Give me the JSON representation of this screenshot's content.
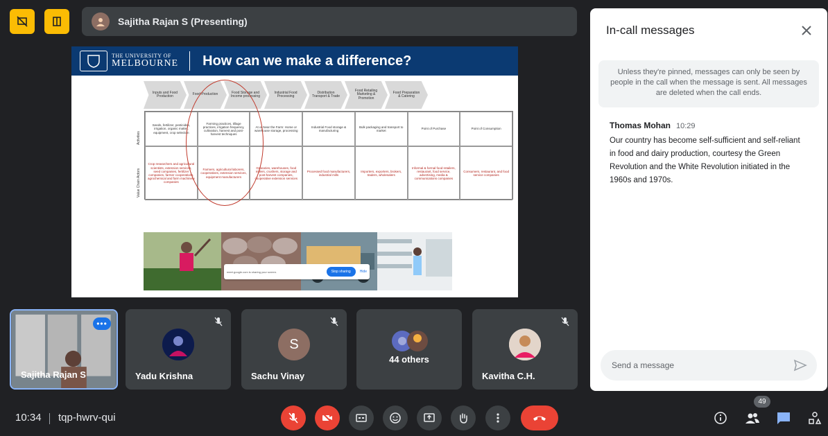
{
  "presenter": {
    "name": "Sajitha Rajan S (Presenting)"
  },
  "slide": {
    "university_line1": "THE UNIVERSITY OF",
    "university_line2": "MELBOURNE",
    "title": "How can we make a difference?",
    "stages": [
      "Inputs and Food Production",
      "Food Production",
      "Food Storage and Income processing",
      "Industrial Food Processing",
      "Distribution Transport & Trade",
      "Food Retailing Marketing & Promotion",
      "Food Preparation & Catering"
    ],
    "row_labels": [
      "Activities",
      "Value Chain Actors"
    ],
    "activities": [
      "Seeds, fertilizer, pesticides, irrigation, organic matter, equipment, crop selection",
      "Farming practices, tillage practices, irrigation frequency, cultivation, harvest and post-harvest techniques",
      "At or Near the Farm: Home or warehouse storage, processing",
      "Industrial Food storage & manufacturing",
      "Bulk packaging and transport to market",
      "Point of Purchase",
      "Point of Consumption"
    ],
    "actors": [
      "Crop researchers and agricultural scientists, extension services, seed companies, fertilizer companies, farmer cooperatives, agrochemical and farm machinery companies",
      "Farmers, agricultural laborers, cooperatives, extension services, equipment manufacturers",
      "Granaries, warehouses, food millers, crushers, storage and post-harvest companies, cooperative extension services",
      "Processed food manufacturers, industrial mills",
      "Importers, exporters, brokers, traders, wholesalers",
      "Informal & formal food retailers, restaurant, food service, advertising, media & communications companies",
      "Consumers, restaurant, and food service companies"
    ],
    "share_bar": {
      "text": "meet.google.com is sharing your screen.",
      "stop_label": "Stop sharing",
      "hide_label": "Hide"
    }
  },
  "participants": [
    {
      "name": "Sajitha Rajan S",
      "self": true
    },
    {
      "name": "Yadu Krishna",
      "muted": true
    },
    {
      "name": "Sachu Vinay",
      "initial": "S",
      "muted": true,
      "color": "#8d6e63"
    },
    {
      "name": "44 others"
    },
    {
      "name": "Kavitha C.H.",
      "muted": true
    }
  ],
  "chat": {
    "title": "In-call messages",
    "notice": "Unless they're pinned, messages can only be seen by people in the call when the message is sent. All messages are deleted when the call ends.",
    "messages": [
      {
        "sender": "Thomas Mohan",
        "time": "10:29",
        "text": "Our country has become self-sufficient and self-reliant in food and dairy production, courtesy the Green Revolution and the White Revolution initiated in the 1960s and 1970s."
      }
    ],
    "input_placeholder": "Send a message"
  },
  "bottom_bar": {
    "time": "10:34",
    "meeting_code": "tqp-hwrv-qui",
    "participant_count": "49"
  },
  "colors": {
    "accent": "#1a73e8",
    "danger": "#ea4335",
    "warning": "#fbbc04",
    "slide_header": "#0b3a72"
  }
}
